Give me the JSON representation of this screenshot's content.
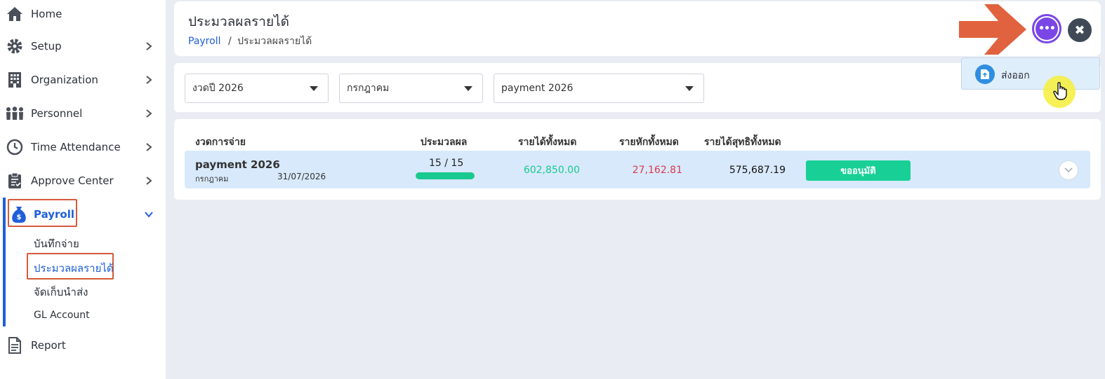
{
  "sidebar": {
    "items": [
      {
        "label": "Home",
        "icon": "home-icon"
      },
      {
        "label": "Setup",
        "icon": "gear-icon"
      },
      {
        "label": "Organization",
        "icon": "building-icon"
      },
      {
        "label": "Personnel",
        "icon": "people-icon"
      },
      {
        "label": "Time Attendance",
        "icon": "clock-icon"
      },
      {
        "label": "Approve Center",
        "icon": "clipboard-icon"
      },
      {
        "label": "Payroll",
        "icon": "money-bag-icon"
      },
      {
        "label": "Report",
        "icon": "document-icon"
      }
    ],
    "payroll_sub": [
      "บันทึกจ่าย",
      "ประมวลผลรายได้",
      "จัดเก็บนำส่ง",
      "GL Account"
    ]
  },
  "header": {
    "title": "ประมวลผลรายได้",
    "breadcrumb_root": "Payroll",
    "breadcrumb_sep": "/",
    "breadcrumb_current": "ประมวลผลรายได้",
    "more_label": "•••",
    "close_label": "✖"
  },
  "popup": {
    "export_label": "ส่งออก"
  },
  "filters": {
    "year": "งวดปี 2026",
    "month": "กรกฎาคม",
    "payment": "payment 2026"
  },
  "table": {
    "headers": [
      "งวดการจ่าย",
      "ประมวลผล",
      "รายได้ทั้งหมด",
      "รายหักทั้งหมด",
      "รายได้สุทธิทั้งหมด"
    ],
    "row": {
      "name": "payment 2026",
      "month": "กรกฎาคม",
      "date": "31/07/2026",
      "count": "15 / 15",
      "progress": 1.0,
      "income": "602,850.00",
      "deduct": "27,162.81",
      "net": "575,687.19",
      "action": "ขออนุมัติ"
    }
  },
  "colors": {
    "accent": "#1f5fd8",
    "income": "#19c98f",
    "deduct": "#d93b4a",
    "approve": "#18d095",
    "highlight_box": "#d45a3c",
    "more_button": "#7a47e6"
  }
}
